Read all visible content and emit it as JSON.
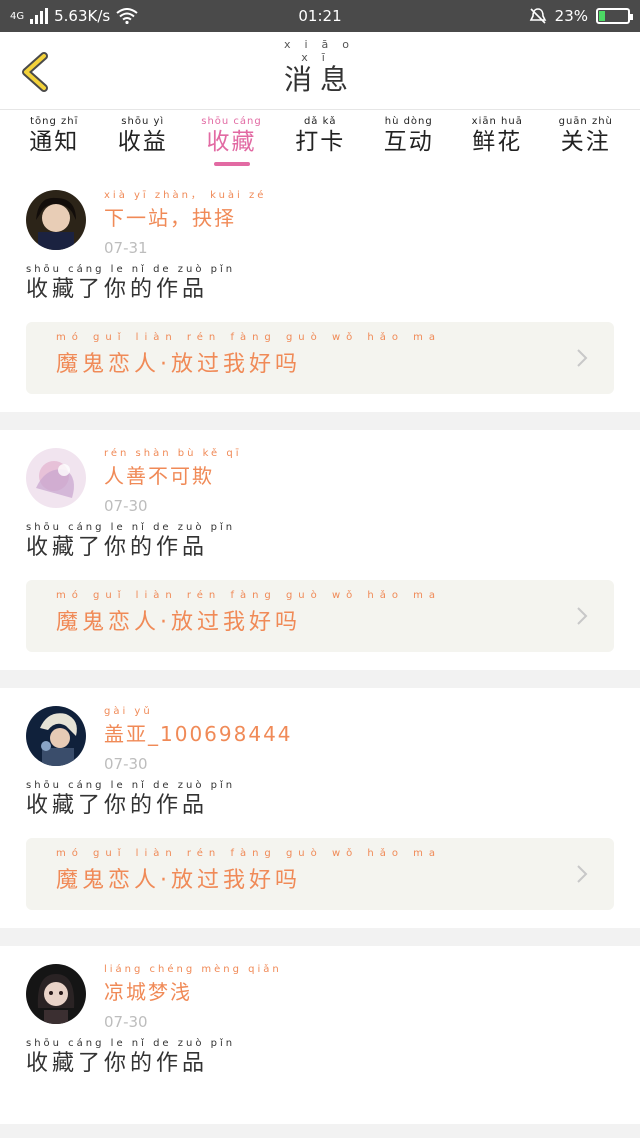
{
  "status_bar": {
    "network": "4G",
    "speed": "5.63K/s",
    "time": "01:21",
    "battery_percent": "23%",
    "battery_level": 0.23
  },
  "header": {
    "title_pinyin": "xiāo xī",
    "title": "消息",
    "back_icon": "chevron-left-icon"
  },
  "tabs": [
    {
      "pinyin": "tōng zhī",
      "label": "通知",
      "active": false
    },
    {
      "pinyin": "shōu yì",
      "label": "收益",
      "active": false
    },
    {
      "pinyin": "shōu cáng",
      "label": "收藏",
      "active": true
    },
    {
      "pinyin": "dǎ kǎ",
      "label": "打卡",
      "active": false
    },
    {
      "pinyin": "hù dòng",
      "label": "互动",
      "active": false
    },
    {
      "pinyin": "xiān huā",
      "label": "鲜花",
      "active": false
    },
    {
      "pinyin": "guān zhù",
      "label": "关注",
      "active": false
    }
  ],
  "colors": {
    "accent_pink": "#e26aa3",
    "name_orange": "#f08a57"
  },
  "items": [
    {
      "user_pinyin": "xià yī zhàn， kuài zé",
      "username": "下一站，抉择",
      "date": "07-31",
      "message_pinyin": "shōu cáng le nǐ de zuò pǐn",
      "message": "收藏了你的作品",
      "work_pinyin": "mó guǐ liàn rén fàng guò wǒ hǎo ma",
      "work_title": "魔鬼恋人·放过我好吗"
    },
    {
      "user_pinyin": "rén shàn bù kě qī",
      "username": "人善不可欺",
      "date": "07-30",
      "message_pinyin": "shōu cáng le nǐ de zuò pǐn",
      "message": "收藏了你的作品",
      "work_pinyin": "mó guǐ liàn rén fàng guò wǒ hǎo ma",
      "work_title": "魔鬼恋人·放过我好吗"
    },
    {
      "user_pinyin": "gài yǔ",
      "username": "盖亚_100698444",
      "date": "07-30",
      "message_pinyin": "shōu cáng le nǐ de zuò pǐn",
      "message": "收藏了你的作品",
      "work_pinyin": "mó guǐ liàn rén fàng guò wǒ hǎo ma",
      "work_title": "魔鬼恋人·放过我好吗"
    },
    {
      "user_pinyin": "liáng chéng mèng qiǎn",
      "username": "凉城梦浅",
      "date": "07-30",
      "message_pinyin": "shōu cáng le nǐ de zuò pǐn",
      "message": "收藏了你的作品",
      "work_pinyin": "",
      "work_title": ""
    }
  ]
}
